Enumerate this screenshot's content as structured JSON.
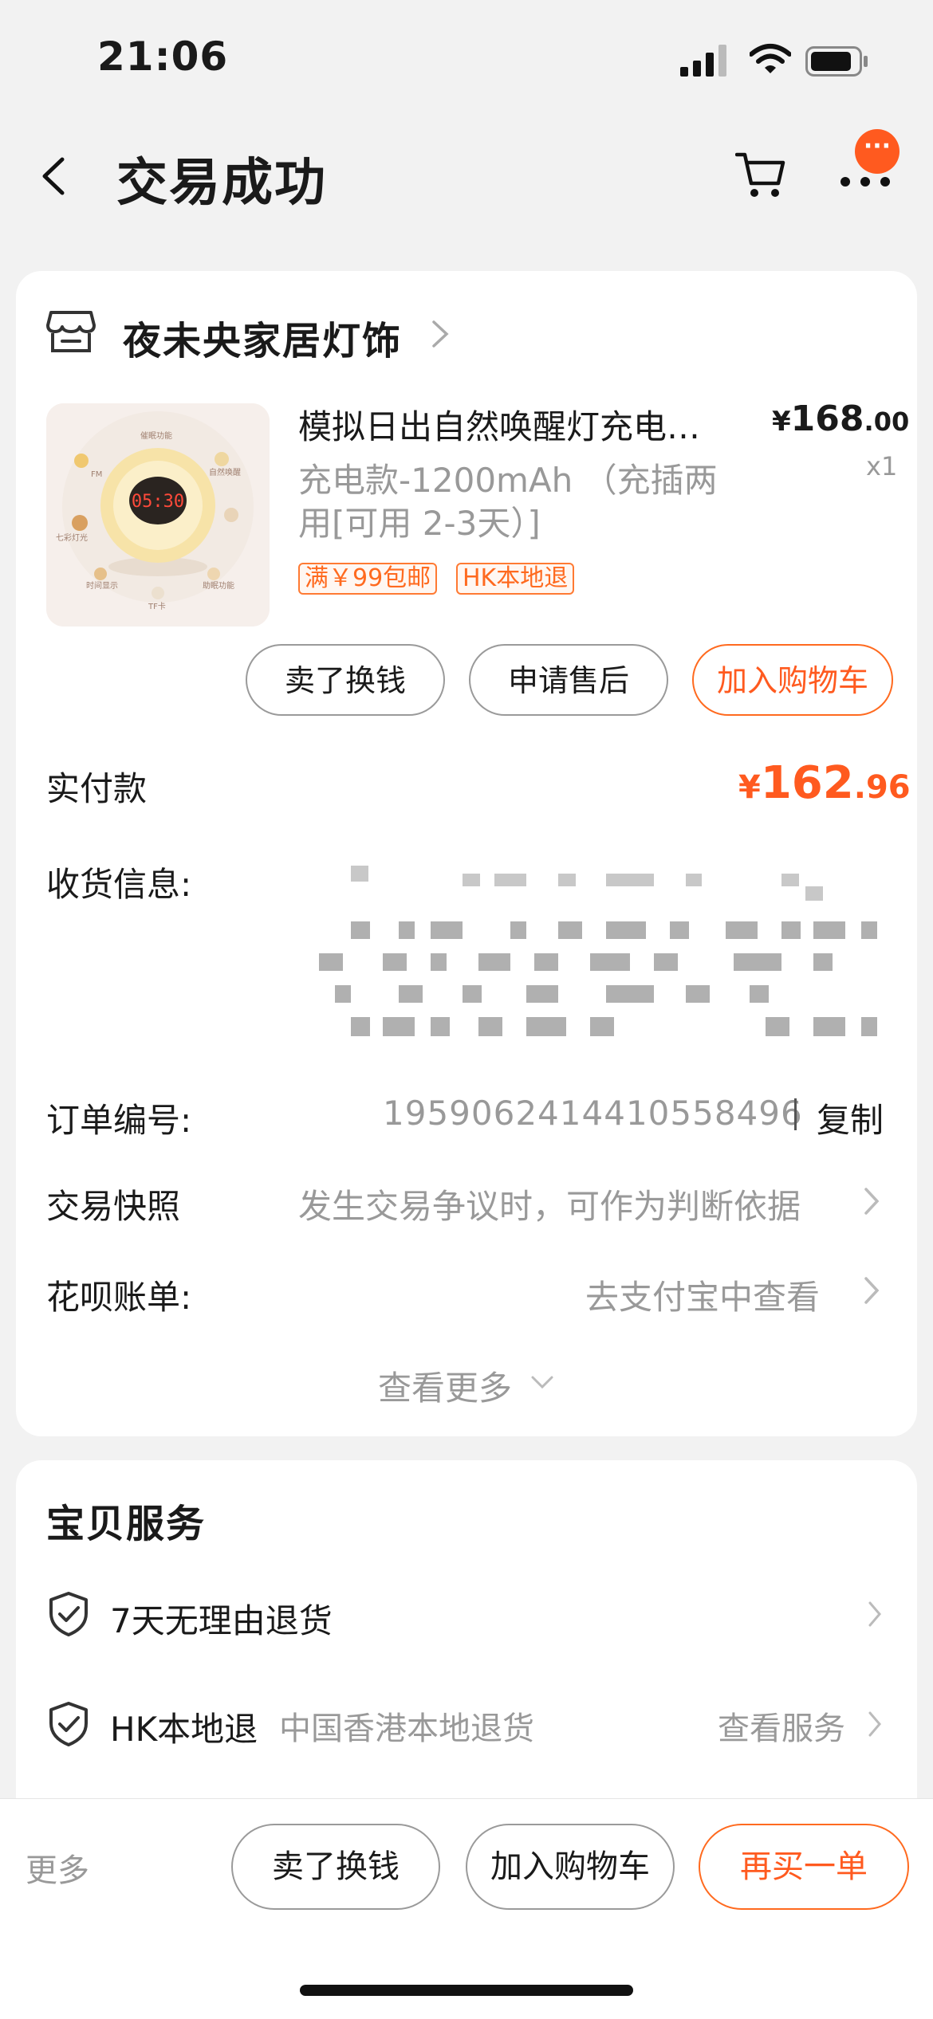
{
  "status_bar": {
    "time": "21:06"
  },
  "header": {
    "title": "交易成功",
    "badge": "···"
  },
  "store": {
    "name": "夜未央家居灯饰"
  },
  "product": {
    "title": "模拟日出自然唤醒灯充电…",
    "price_currency": "¥",
    "price_int": "168",
    "price_dec": ".00",
    "quantity": "x1",
    "spec": "充电款-1200mAh （充插两用[可用 2-3天）]",
    "tags": [
      "满￥99包邮",
      "HK本地退"
    ],
    "image_clock": "05:30",
    "image_labels": [
      "FM",
      "七彩灯光",
      "时间显示",
      "TF卡",
      "催眠功能",
      "自然唤醒",
      "助眠功能"
    ]
  },
  "actions": {
    "sell": "卖了换钱",
    "after_sale": "申请售后",
    "add_cart": "加入购物车"
  },
  "order_info": {
    "paid_label": "实付款",
    "paid_currency": "¥",
    "paid_int": "162",
    "paid_dec": ".96",
    "address_label": "收货信息:",
    "order_no_label": "订单编号:",
    "order_no": "1959062414410558496",
    "copy": "复制",
    "snapshot_label": "交易快照",
    "snapshot_value": "发生交易争议时，可作为判断依据",
    "bill_label": "花呗账单:",
    "bill_value": "去支付宝中查看",
    "see_more": "查看更多"
  },
  "services": {
    "title": "宝贝服务",
    "items": [
      {
        "label": "7天无理由退货"
      },
      {
        "label": "HK本地退",
        "sub": "中国香港本地退货",
        "link": "查看服务"
      }
    ]
  },
  "bottom_bar": {
    "more": "更多",
    "sell": "卖了换钱",
    "add_cart": "加入购物车",
    "rebuy": "再买一单"
  },
  "colors": {
    "accent": "#ff5a1f",
    "muted": "#999999",
    "background": "#f2f2f2"
  }
}
